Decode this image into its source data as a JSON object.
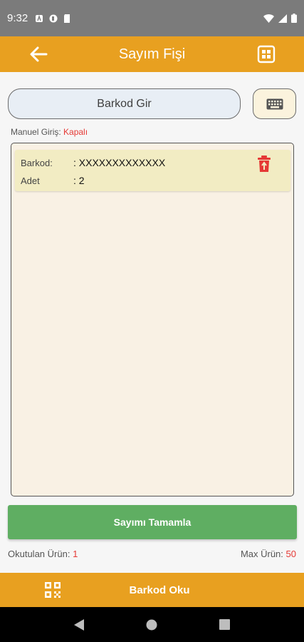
{
  "status_bar": {
    "time": "9:32"
  },
  "app_bar": {
    "title": "Sayım Fişi"
  },
  "barcode_entry": {
    "placeholder": "Barkod Gir"
  },
  "manual_entry": {
    "label": "Manuel Giriş:",
    "value": "Kapalı"
  },
  "items": [
    {
      "barcode_label": "Barkod:",
      "barcode_value": ": XXXXXXXXXXXXX",
      "qty_label": "Adet",
      "qty_value": ": 2"
    }
  ],
  "actions": {
    "complete_label": "Sayımı Tamamla",
    "scan_label": "Barkod Oku"
  },
  "footer": {
    "scanned_label": "Okutulan Ürün:",
    "scanned_value": "1",
    "max_label": "Max Ürün:",
    "max_value": "50"
  },
  "colors": {
    "accent": "#e8a020",
    "success": "#5fae62",
    "alert": "#e53935"
  },
  "icons": {
    "back": "arrow-left-icon",
    "app_bar_action": "scan-frame-icon",
    "keyboard": "keyboard-icon",
    "delete": "trash-icon",
    "qr": "qr-code-icon"
  }
}
